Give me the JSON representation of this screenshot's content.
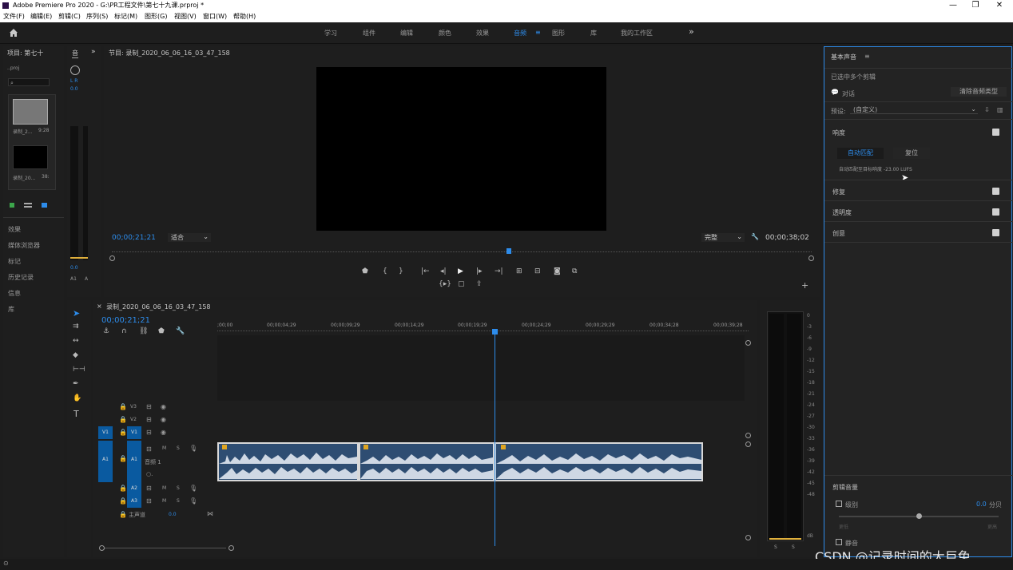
{
  "window": {
    "title": "Adobe Premiere Pro 2020 - G:\\PR工程文件\\第七十九课.prproj *",
    "minimize": "—",
    "maximize": "❐",
    "close": "✕"
  },
  "menu": [
    "文件(F)",
    "编辑(E)",
    "剪辑(C)",
    "序列(S)",
    "标记(M)",
    "图形(G)",
    "视图(V)",
    "窗口(W)",
    "帮助(H)"
  ],
  "workspaces": {
    "items": [
      "学习",
      "组件",
      "编辑",
      "颜色",
      "效果",
      "音频",
      "图形",
      "库",
      "我的工作区"
    ],
    "active": "音频",
    "overflow": "»"
  },
  "project_panel": {
    "title": "项目: 第七十",
    "file": "..proj",
    "thumb1_name": "录制_2...",
    "thumb1_dur": "9:28",
    "thumb2_name": "录制_20...",
    "thumb2_dur": "38:",
    "side_panels": [
      "效果",
      "媒体浏览器",
      "标记",
      "历史记录",
      "信息",
      "库"
    ]
  },
  "audio_mini": {
    "tab": "音",
    "lr": "L R",
    "val": "0.0",
    "bottom_val": "0.0",
    "a1": "A1",
    "a": "A"
  },
  "program_monitor": {
    "title": "节目: 录制_2020_06_06_16_03_47_158",
    "timecode": "00;00;21;21",
    "fit": "适合",
    "quality": "完整",
    "duration": "00;00;38;02"
  },
  "timeline": {
    "sequence": "录制_2020_06_06_16_03_47_158",
    "timecode": "00;00;21;21",
    "ruler": [
      ";00;00",
      "00;00;04;29",
      "00;00;09;29",
      "00;00;14;29",
      "00;00;19;29",
      "00;00;24;29",
      "00;00;29;29",
      "00;00;34;28",
      "00;00;39;28"
    ],
    "tracks": {
      "v3": "V3",
      "v2": "V2",
      "v1": "V1",
      "v1_src": "V1",
      "a1": "A1",
      "a1_src": "A1",
      "a1_name": "音频 1",
      "a2": "A2",
      "a3": "A3",
      "master": "主声道",
      "master_val": "0.0",
      "m": "M",
      "s": "S"
    }
  },
  "vu_meter": {
    "scale": [
      "0",
      "-3",
      "-6",
      "-9",
      "-12",
      "-15",
      "-18",
      "-21",
      "-24",
      "-27",
      "-30",
      "-33",
      "-36",
      "-39",
      "-42",
      "-45",
      "-48",
      "dB"
    ],
    "s1": "S",
    "s2": "S"
  },
  "essential_sound": {
    "title": "基本声音",
    "selection": "已选中多个剪辑",
    "dialog": "对话",
    "clear_type": "清除音频类型",
    "preset_label": "预设:",
    "preset_value": "(自定义)",
    "loudness": "响度",
    "auto_match": "自动匹配",
    "reset": "复位",
    "auto_match_note": "自动匹配至目标响度 -23.00 LUFS",
    "repair": "修复",
    "clarity": "透明度",
    "creative": "创意",
    "clip_volume": "剪辑音量",
    "level": "级别",
    "level_value": "0.0",
    "level_unit": "分贝",
    "level_min": "更低",
    "level_max": "更高",
    "mute": "静音"
  },
  "watermark": "CSDN @记录时间的大巨兔"
}
